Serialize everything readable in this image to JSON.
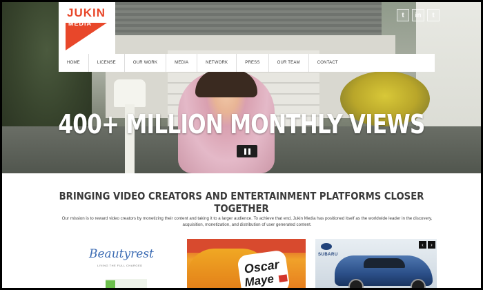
{
  "brand": {
    "line1": "JUKIN",
    "line2": "MEDIA",
    "accent": "#e8472a"
  },
  "social": [
    {
      "icon": "twitter-icon",
      "glyph": "t"
    },
    {
      "icon": "linkedin-icon",
      "glyph": "in"
    },
    {
      "icon": "tumblr-icon",
      "glyph": "t"
    }
  ],
  "nav": [
    "HOME",
    "LICENSE",
    "OUR WORK",
    "MEDIA",
    "NETWORK",
    "PRESS",
    "OUR TEAM",
    "CONTACT"
  ],
  "hero": {
    "headline": "400+ MILLION MONTHLY VIEWS"
  },
  "main": {
    "tagline": "BRINGING VIDEO CREATORS AND ENTERTAINMENT PLATFORMS CLOSER TOGETHER",
    "mission": "Our mission is to reward video creators by monetizing their content and taking it to a larger audience. To achieve that end, Jukin Media has positioned itself as the worldwide leader in the discovery, acquisition, monetization, and distribution of user generated content."
  },
  "cards": {
    "beauty": {
      "logo": "Beautyrest",
      "sub": "LIVING THE FULL CHARGED"
    },
    "oscar": {
      "line1": "Oscar",
      "line2": "Maye"
    },
    "subaru": {
      "label": "SUBARU"
    }
  },
  "carousel": {
    "prev": "‹",
    "next": "›"
  }
}
